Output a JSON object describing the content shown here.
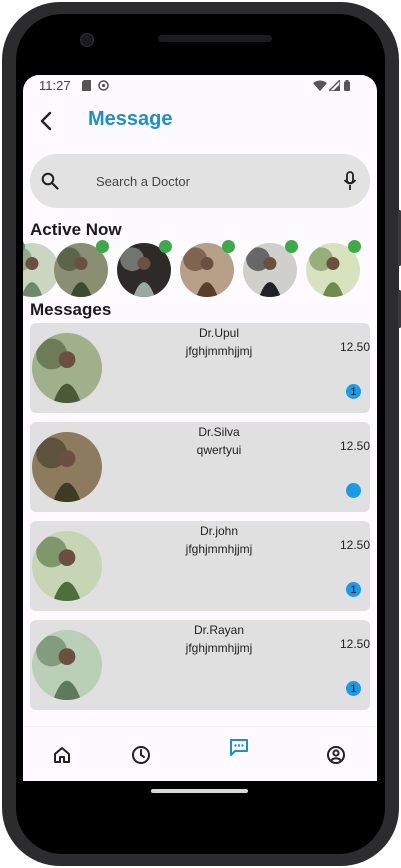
{
  "status_bar": {
    "time": "11:27"
  },
  "header": {
    "title": "Message"
  },
  "search": {
    "placeholder": "Search a Doctor"
  },
  "sections": {
    "active_now": "Active Now",
    "messages": "Messages"
  },
  "colors": {
    "accent": "#1e8fcd",
    "online": "#3daa4a",
    "unread": "#1a9be8",
    "card": "#e0e0e0"
  },
  "active_now": [
    {
      "palette": [
        "#c9d7c0",
        "#6e8a6a"
      ]
    },
    {
      "palette": [
        "#8a8f72",
        "#3e4a30"
      ]
    },
    {
      "palette": [
        "#2d2a28",
        "#9ca9a0"
      ]
    },
    {
      "palette": [
        "#b6a088",
        "#5a3e2c"
      ]
    },
    {
      "palette": [
        "#cfcfcb",
        "#1f2224"
      ]
    },
    {
      "palette": [
        "#d7e3bf",
        "#6e8a4e"
      ]
    }
  ],
  "messages": [
    {
      "name": "Dr.Upul",
      "preview": "jfghjmmhjjmj",
      "time": "12.50",
      "unread": "1",
      "palette": [
        "#9fb08a",
        "#4a5a36"
      ]
    },
    {
      "name": "Dr.Silva",
      "preview": "qwertyui",
      "time": "12.50",
      "unread": "",
      "palette": [
        "#8c7b5c",
        "#3f3a24"
      ]
    },
    {
      "name": "Dr.john",
      "preview": "jfghjmmhjjmj",
      "time": "12.50",
      "unread": "1",
      "palette": [
        "#c6d6b4",
        "#4f6e3a"
      ]
    },
    {
      "name": "Dr.Rayan",
      "preview": "jfghjmmhjjmj",
      "time": "12.50",
      "unread": "1",
      "palette": [
        "#b9cfb6",
        "#5e7a5c"
      ]
    }
  ],
  "bottom_nav": [
    {
      "icon": "home-icon"
    },
    {
      "icon": "clock-icon"
    },
    {
      "icon": "chat-icon",
      "active": true
    },
    {
      "icon": "profile-icon"
    }
  ]
}
